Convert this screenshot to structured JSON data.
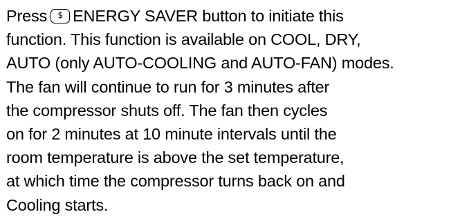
{
  "paragraph": {
    "line_1": {
      "prefix": "Press",
      "button_icon_glyph": "$",
      "suffix": "ENERGY SAVER button to initiate this"
    },
    "line_2": "function. This function is available on COOL, DRY,",
    "line_3": "AUTO (only AUTO-COOLING and AUTO-FAN) modes.",
    "line_4": "The fan will continue to run for 3 minutes after",
    "line_5": "the compressor shuts off. The fan then cycles",
    "line_6": "on for 2 minutes at 10 minute intervals until the",
    "line_7": "room temperature is above the set temperature,",
    "line_8": "at which time the compressor turns back on and",
    "line_9": "Cooling starts."
  },
  "icons": {
    "energy_saver_button": "dollar-sign-button-icon"
  }
}
